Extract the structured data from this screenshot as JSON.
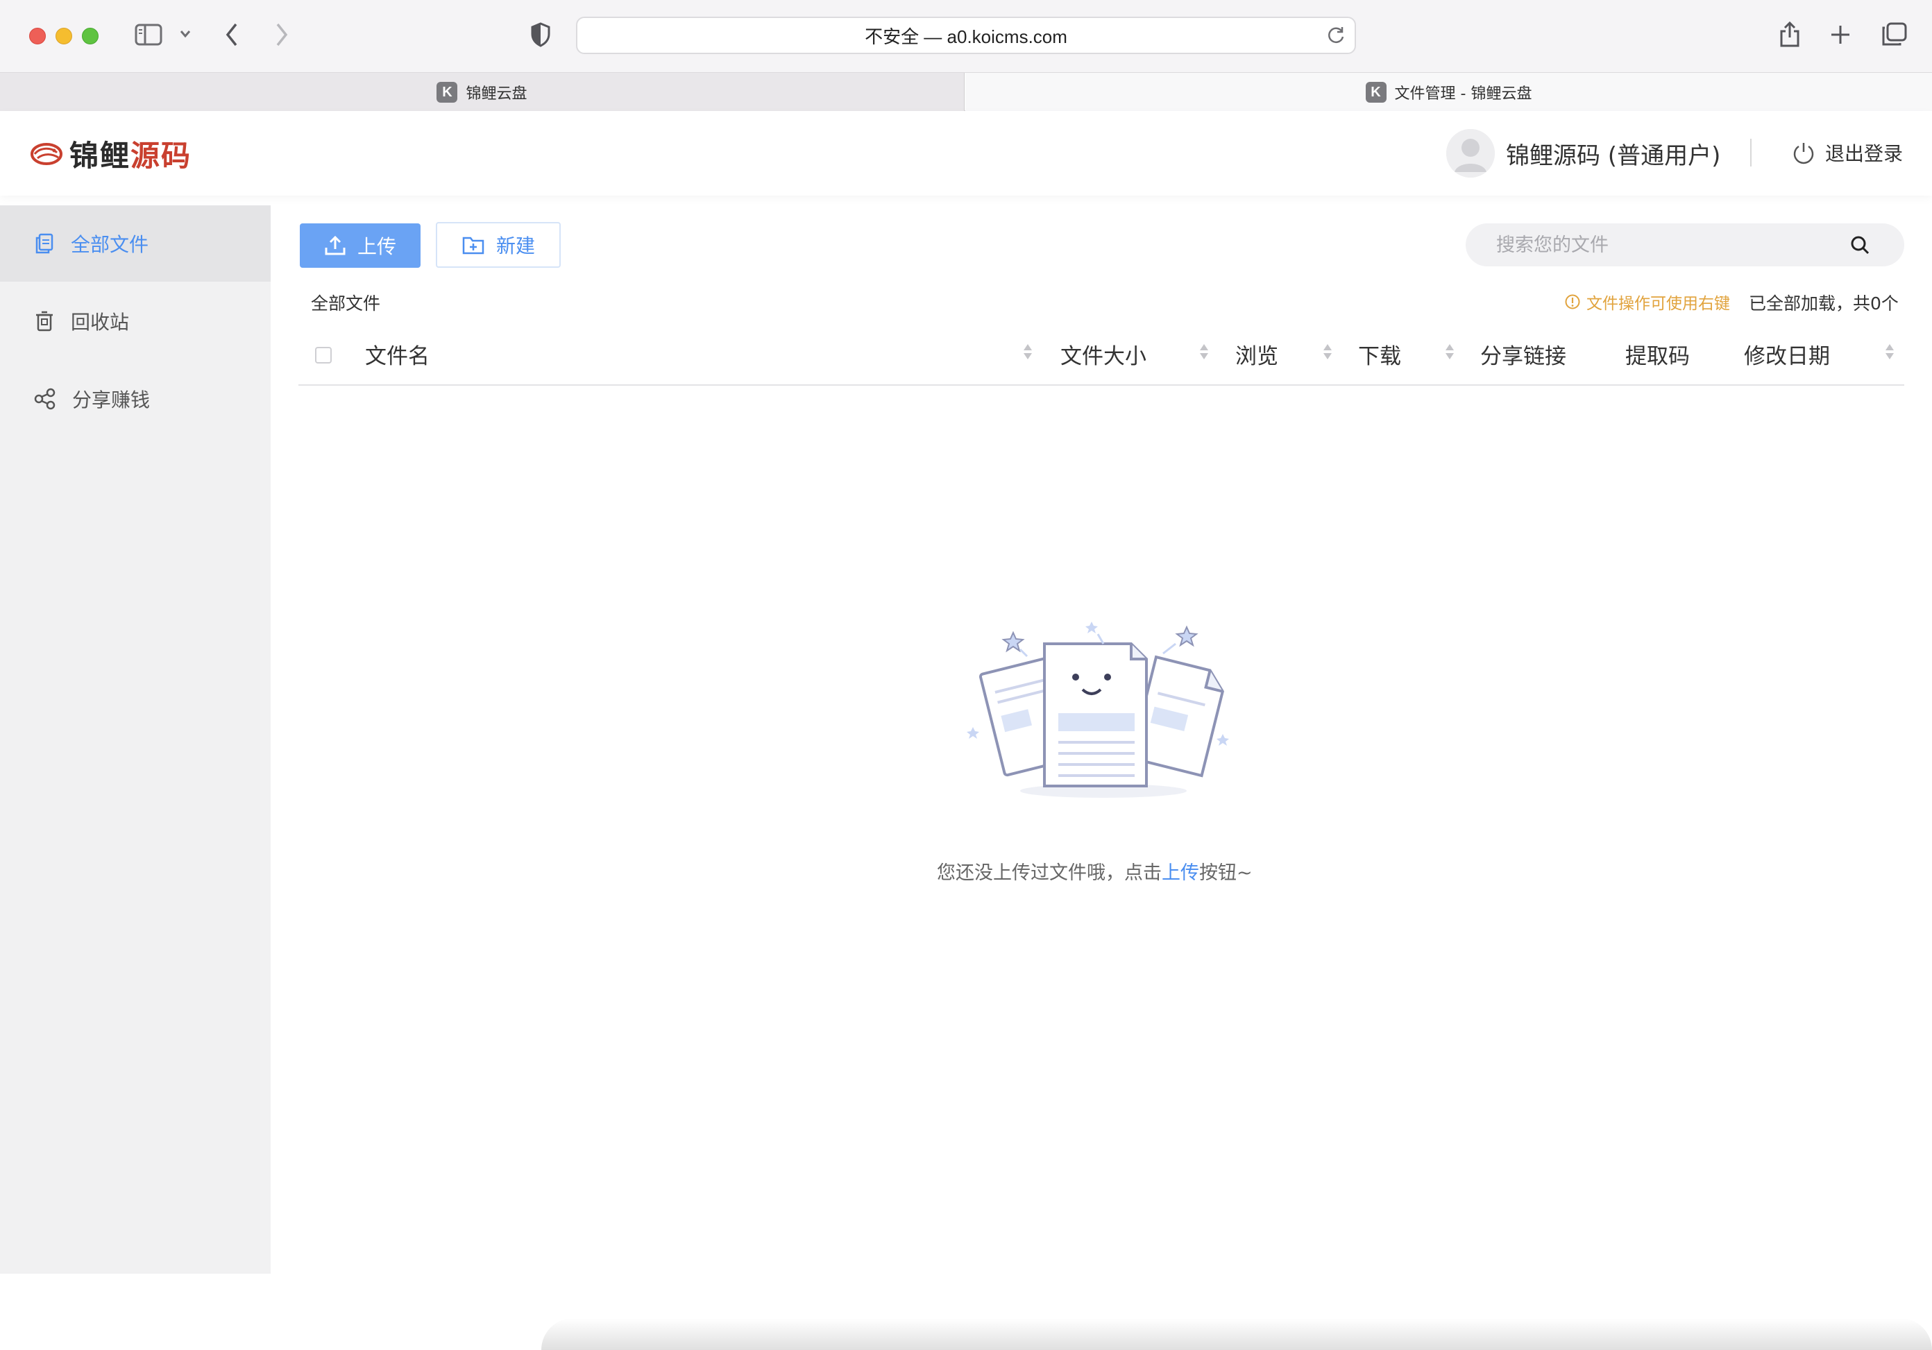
{
  "browser": {
    "url_text": "不安全 — a0.koicms.com",
    "tabs": [
      {
        "label": "锦鲤云盘",
        "favicon": "K"
      },
      {
        "label": "文件管理 - 锦鲤云盘",
        "favicon": "K"
      }
    ]
  },
  "header": {
    "logo_main": "锦鲤",
    "logo_accent": "源码",
    "username": "锦鲤源码 (普通用户)",
    "logout_label": "退出登录"
  },
  "sidebar": {
    "items": [
      {
        "label": "全部文件",
        "icon": "files-icon",
        "active": true
      },
      {
        "label": "回收站",
        "icon": "trash-icon",
        "active": false
      },
      {
        "label": "分享赚钱",
        "icon": "share-icon",
        "active": false
      }
    ]
  },
  "toolbar": {
    "upload_label": "上传",
    "new_label": "新建",
    "search_placeholder": "搜索您的文件"
  },
  "breadcrumb": "全部文件",
  "hint": "文件操作可使用右键",
  "status": "已全部加载，共0个",
  "table": {
    "columns": [
      "文件名",
      "文件大小",
      "浏览",
      "下载",
      "分享链接",
      "提取码",
      "修改日期"
    ]
  },
  "empty": {
    "prefix": "您还没上传过文件哦，点击",
    "link": "上传",
    "suffix": "按钮~"
  },
  "colors": {
    "accent": "#4a8ef0",
    "upload_button": "#6aa3f4",
    "hint": "#e1a33d",
    "logo_red": "#c9402f"
  }
}
